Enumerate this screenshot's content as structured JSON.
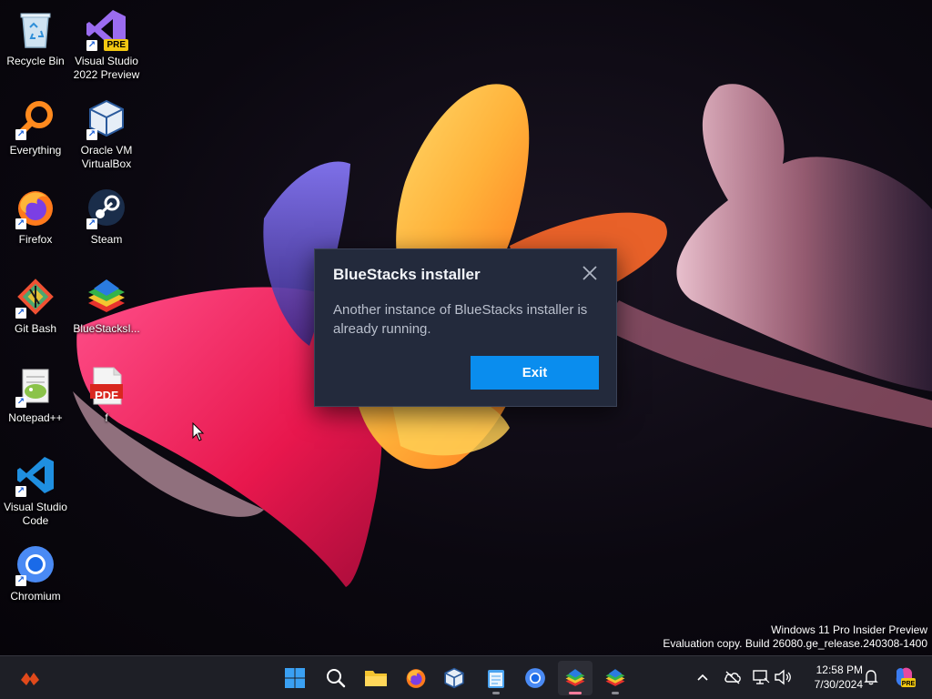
{
  "desktop": {
    "icons": [
      {
        "id": "recycle-bin",
        "label": "Recycle Bin"
      },
      {
        "id": "visual-studio-2022-preview",
        "label": "Visual Studio 2022 Preview",
        "badge": "PRE"
      },
      {
        "id": "everything",
        "label": "Everything"
      },
      {
        "id": "oracle-vm-virtualbox",
        "label": "Oracle VM VirtualBox"
      },
      {
        "id": "firefox",
        "label": "Firefox"
      },
      {
        "id": "steam",
        "label": "Steam"
      },
      {
        "id": "git-bash",
        "label": "Git Bash"
      },
      {
        "id": "bluestacks-installer",
        "label": "BlueStacksI..."
      },
      {
        "id": "notepad-plus-plus",
        "label": "Notepad++"
      },
      {
        "id": "pdf-file",
        "label": "f",
        "badge": "PDF"
      },
      {
        "id": "visual-studio-code",
        "label": "Visual Studio Code"
      },
      {
        "id": "chromium",
        "label": "Chromium"
      }
    ]
  },
  "dialog": {
    "title": "BlueStacks installer",
    "message": "Another instance of BlueStacks installer is already running.",
    "exit_label": "Exit"
  },
  "watermark": {
    "line1": "Windows 11 Pro Insider Preview",
    "line2": "Evaluation copy. Build 26080.ge_release.240308-1400"
  },
  "taskbar": {
    "items": [
      "start-icon",
      "search-icon",
      "file-explorer-icon",
      "firefox-icon",
      "virtualbox-icon",
      "notepad-icon",
      "chromium-icon",
      "bluestacks-icon",
      "bluestacks-icon"
    ],
    "tray": {
      "time": "12:58 PM",
      "date": "7/30/2024"
    }
  },
  "colors": {
    "dialog_bg": "#232a3c",
    "accent": "#0a8dee",
    "taskbar_bg": "#1e1f26"
  }
}
